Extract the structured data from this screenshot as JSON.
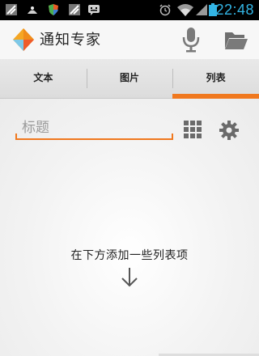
{
  "status_bar": {
    "time": "22:48",
    "icons": [
      "notification-icon",
      "notification-icon",
      "shield-icon",
      "notification-icon",
      "bbm-icon",
      "alarm-icon",
      "wifi-icon",
      "signal-icon",
      "battery-icon"
    ],
    "time_color": "#33b5e5"
  },
  "action_bar": {
    "title": "通知专家",
    "actions": [
      "microphone-icon",
      "folder-icon"
    ]
  },
  "tabs": [
    {
      "label": "文本",
      "selected": false
    },
    {
      "label": "图片",
      "selected": false
    },
    {
      "label": "列表",
      "selected": true
    }
  ],
  "editor": {
    "title_placeholder": "标题",
    "title_value": "",
    "actions": [
      "grid-icon",
      "gear-icon"
    ]
  },
  "empty_hint": "在下方添加一些列表项",
  "colors": {
    "accent": "#f0781e",
    "status_bar_bg": "#000000"
  }
}
